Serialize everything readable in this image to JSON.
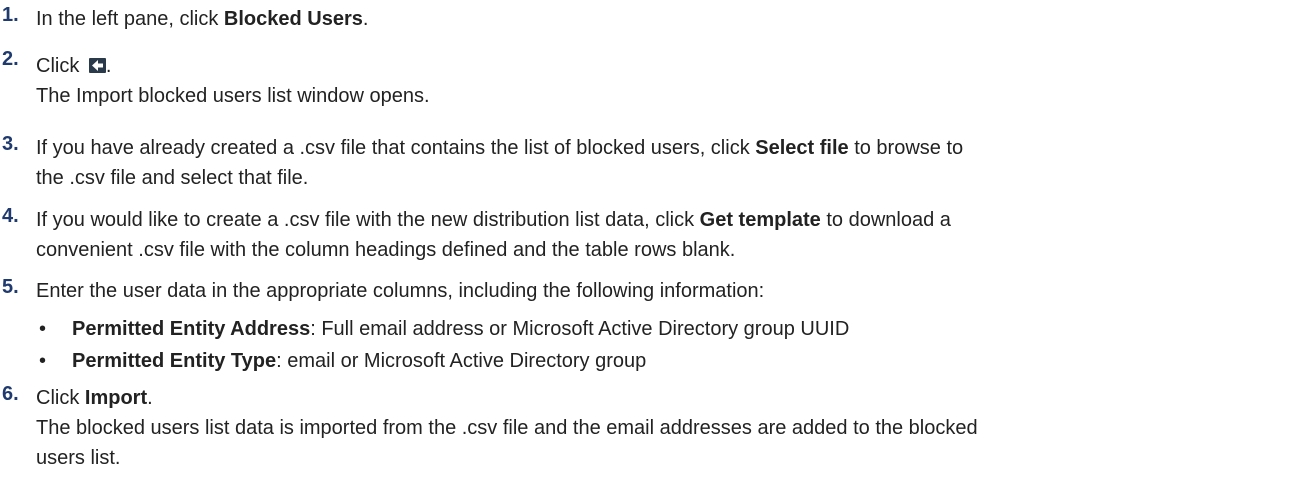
{
  "steps": [
    {
      "num": "1.",
      "pre": "In the left pane, click ",
      "bold": "Blocked Users",
      "post": "."
    },
    {
      "num": "2.",
      "pre": "Click ",
      "icon": "import-icon",
      "post": ".",
      "note": "The Import blocked users list window opens."
    },
    {
      "num": "3.",
      "l1_pre": "If you have already created a .csv file that contains the list of blocked users, click ",
      "l1_bold": "Select file",
      "l1_post": " to browse to",
      "l2": "the .csv file and select that file."
    },
    {
      "num": "4.",
      "l1_pre": "If you would like to create a .csv file with the new distribution list data, click ",
      "l1_bold": "Get template",
      "l1_post": " to download a",
      "l2": "convenient .csv file with the column headings defined and the table rows blank."
    },
    {
      "num": "5.",
      "text": "Enter the user data in the appropriate columns, including the following information:",
      "bullets": [
        {
          "bold": "Permitted Entity Address",
          "rest": ": Full email address or Microsoft Active Directory group UUID"
        },
        {
          "bold": "Permitted Entity Type",
          "rest": ": email or Microsoft Active Directory group"
        }
      ]
    },
    {
      "num": "6.",
      "pre": "Click ",
      "bold": "Import",
      "post": ".",
      "note_l1": "The blocked users list data is imported from the .csv file and the email addresses are added to the blocked",
      "note_l2": "users list."
    }
  ],
  "bullet_char": "•",
  "colors": {
    "text": "#222222",
    "number": "#1f3a6e",
    "icon_bg": "#2a3a4a",
    "icon_arrow": "#ffffff"
  }
}
